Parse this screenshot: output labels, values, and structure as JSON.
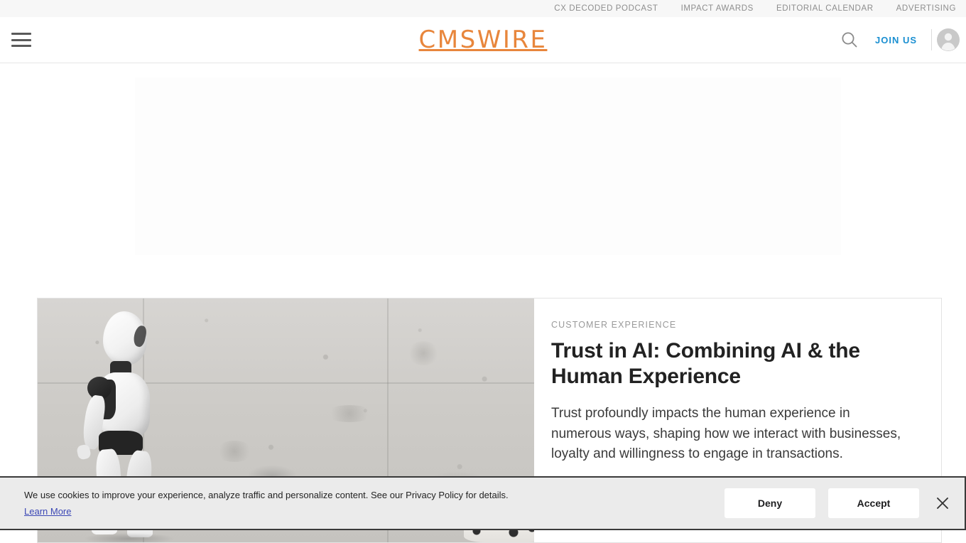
{
  "topbar": {
    "links": [
      {
        "label": "CX DECODED PODCAST"
      },
      {
        "label": "IMPACT AWARDS"
      },
      {
        "label": "EDITORIAL CALENDAR"
      },
      {
        "label": "ADVERTISING"
      }
    ]
  },
  "header": {
    "logo": "CMSWIRE",
    "join_label": "JOIN US",
    "logo_color": "#e8863c",
    "join_color": "#1a8fd1"
  },
  "article": {
    "kicker": "CUSTOMER EXPERIENCE",
    "headline": "Trust in AI: Combining AI & the Human Experience",
    "dek": "Trust profoundly impacts the human experience in numerous ways, shaping how we interact with businesses, loyalty and willingness to engage in transactions."
  },
  "cookie": {
    "message": "We use cookies to improve your experience, analyze traffic and personalize content. See our Privacy Policy for details.",
    "learn_more": "Learn More",
    "deny_label": "Deny",
    "accept_label": "Accept"
  }
}
